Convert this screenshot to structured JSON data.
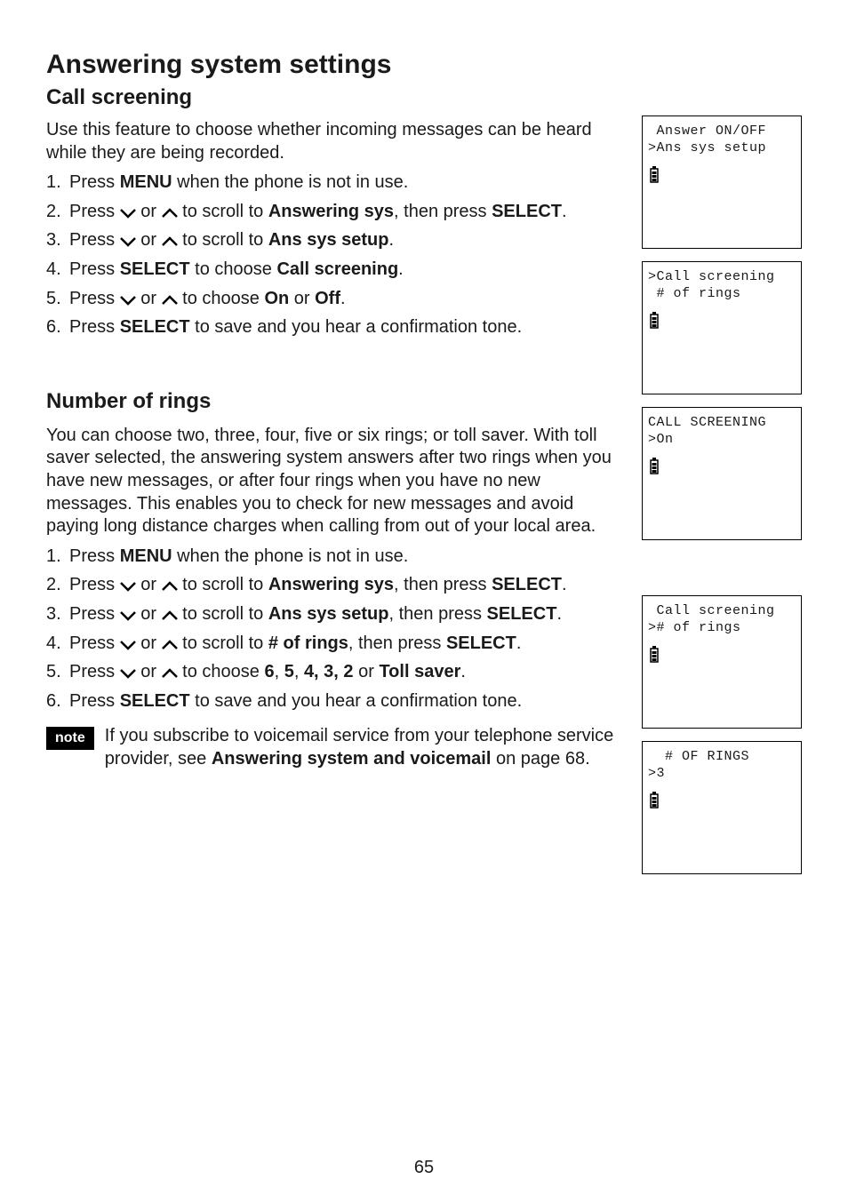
{
  "page_number": "65",
  "headings": {
    "h1": "Answering system settings",
    "h2_call_screening": "Call screening",
    "h2_number_of_rings": "Number of rings"
  },
  "call_screening": {
    "intro": "Use this feature to choose whether incoming messages can be heard while they are being recorded.",
    "steps": [
      {
        "num": "1.",
        "pre": "Press ",
        "b1": "MENU",
        "post": " when the phone is not in use."
      },
      {
        "num": "2.",
        "pre": "Press ",
        "arrows": true,
        "mid": " to scroll to ",
        "b1": "Answering sys",
        "mid2": ", then press ",
        "b2": "SELECT",
        "post": "."
      },
      {
        "num": "3.",
        "pre": "Press ",
        "arrows": true,
        "mid": " to scroll to ",
        "b1": "Ans sys setup",
        "post": "."
      },
      {
        "num": "4.",
        "pre": "Press ",
        "b1": "SELECT",
        "mid": " to choose ",
        "b2": "Call screening",
        "post": "."
      },
      {
        "num": "5.",
        "pre": "Press ",
        "arrows": true,
        "mid": " to choose ",
        "b1": "On",
        "mid2": " or ",
        "b2": "Off",
        "post": "."
      },
      {
        "num": "6.",
        "pre": "Press ",
        "b1": "SELECT",
        "post": " to save and you hear a confirmation tone."
      }
    ]
  },
  "number_of_rings": {
    "intro": "You can choose two, three, four, five or six rings; or toll saver. With toll saver selected, the answering system answers after two rings when you have new messages, or after four rings when you have no new messages. This enables you to check for new messages and avoid paying long distance charges when calling from out of your local area.",
    "steps": [
      {
        "num": "1.",
        "pre": "Press ",
        "b1": "MENU",
        "post": " when the phone is not in use."
      },
      {
        "num": "2.",
        "pre": "Press ",
        "arrows": true,
        "mid": " to scroll to ",
        "b1": "Answering sys",
        "mid2": ", then press ",
        "b2": "SELECT",
        "post": "."
      },
      {
        "num": "3.",
        "pre": "Press ",
        "arrows": true,
        "mid": " to scroll to ",
        "b1": "Ans sys setup",
        "mid2": ", then press ",
        "b2": "SELECT",
        "post": "."
      },
      {
        "num": "4.",
        "pre": "Press ",
        "arrows": true,
        "mid": " to scroll to ",
        "b1": "# of rings",
        "mid2": ", then press ",
        "b2": "SELECT",
        "post": "."
      },
      {
        "num": "5.",
        "pre": "Press ",
        "arrows": true,
        "mid": " to choose ",
        "b1": "6",
        "mid2": ", ",
        "b2": "5",
        "mid3": ", ",
        "b3": "4, 3, 2",
        "mid4": " or ",
        "b4": "Toll saver",
        "post": "."
      },
      {
        "num": "6.",
        "pre": "Press ",
        "b1": "SELECT",
        "post": " to save and you hear a confirmation tone."
      }
    ]
  },
  "note": {
    "label": "note",
    "text_pre": "If you subscribe to voicemail service from your telephone service provider, see ",
    "text_b": "Answering system and voicemail",
    "text_post": " on page 68."
  },
  "lcd_screens": {
    "s1": {
      "line1": " Answer ON/OFF",
      "line2": ">Ans sys setup"
    },
    "s2": {
      "line1": ">Call screening",
      "line2": " # of rings"
    },
    "s3": {
      "line1": "CALL SCREENING",
      "line2": ">On"
    },
    "s4": {
      "line1": " Call screening",
      "line2": "># of rings"
    },
    "s5": {
      "line1": "  # OF RINGS",
      "line2": ">3"
    }
  }
}
